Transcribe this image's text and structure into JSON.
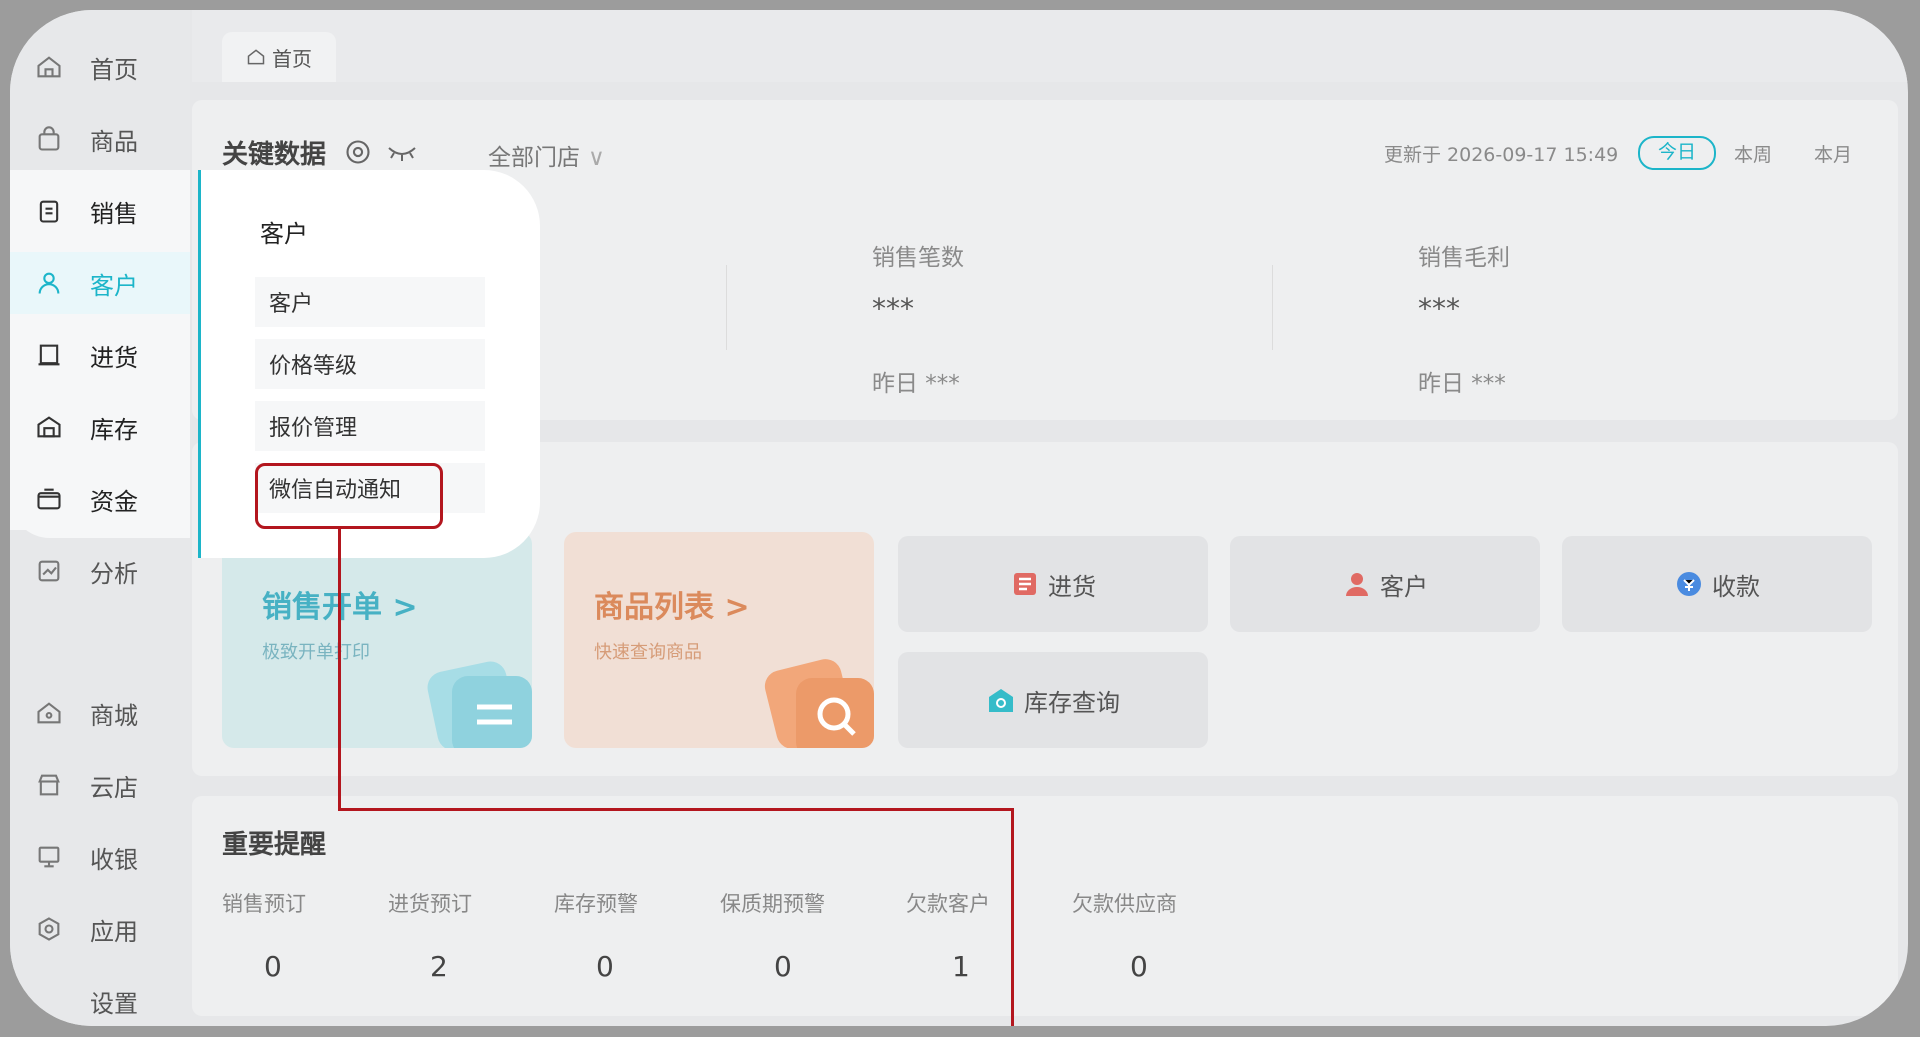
{
  "sidebar": {
    "items": [
      {
        "label": "首页",
        "icon": "home-icon"
      },
      {
        "label": "商品",
        "icon": "bag-icon"
      },
      {
        "label": "销售",
        "icon": "clipboard-icon"
      },
      {
        "label": "客户",
        "icon": "user-icon"
      },
      {
        "label": "进货",
        "icon": "book-icon"
      },
      {
        "label": "库存",
        "icon": "warehouse-icon"
      },
      {
        "label": "资金",
        "icon": "wallet-icon"
      },
      {
        "label": "分析",
        "icon": "chart-icon"
      },
      {
        "label": "商城",
        "icon": "shop-icon"
      },
      {
        "label": "云店",
        "icon": "store-icon"
      },
      {
        "label": "收银",
        "icon": "pos-icon"
      },
      {
        "label": "应用",
        "icon": "hexagon-icon"
      },
      {
        "label": "设置",
        "icon": "settings-icon"
      }
    ]
  },
  "tabs": {
    "home": "首页"
  },
  "key_data": {
    "title": "关键数据",
    "store_select": "全部门店",
    "updated": "更新于 2026-09-17 15:49",
    "periods": [
      "今日",
      "本周",
      "本月"
    ],
    "metrics": [
      {
        "label": "销售笔数",
        "value": "***",
        "yesterday": "昨日 ***"
      },
      {
        "label": "销售毛利",
        "value": "***",
        "yesterday": "昨日 ***"
      }
    ]
  },
  "quick": {
    "sales": {
      "title": "销售开单 >",
      "sub": "极致开单打印"
    },
    "products": {
      "title": "商品列表 >",
      "sub": "快速查询商品"
    },
    "buttons": [
      "进货",
      "客户",
      "收款",
      "库存查询"
    ]
  },
  "popup": {
    "title": "客户",
    "items": [
      "客户",
      "价格等级",
      "报价管理",
      "微信自动通知"
    ]
  },
  "reminders": {
    "title": "重要提醒",
    "items": [
      {
        "label": "销售预订",
        "value": "0"
      },
      {
        "label": "进货预订",
        "value": "2"
      },
      {
        "label": "库存预警",
        "value": "0"
      },
      {
        "label": "保质期预警",
        "value": "0"
      },
      {
        "label": "欠款客户",
        "value": "1"
      },
      {
        "label": "欠款供应商",
        "value": "0"
      }
    ]
  },
  "colors": {
    "accent": "#1cb5c9",
    "highlight": "#b3161e",
    "sales_card": "#d5e9ea",
    "product_card": "#f1dfd5"
  }
}
